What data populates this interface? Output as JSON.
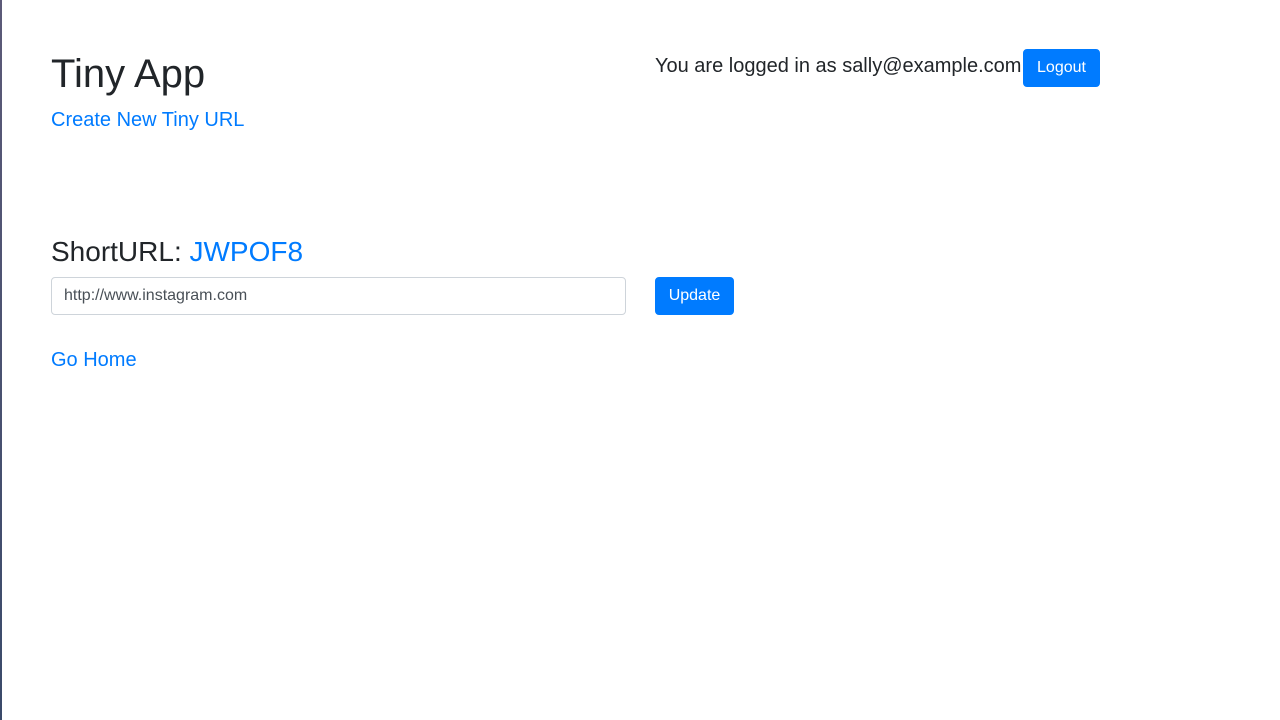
{
  "header": {
    "title": "Tiny App",
    "create_link": "Create New Tiny URL",
    "login_status": "You are logged in as sally@example.com",
    "logout_label": "Logout"
  },
  "main": {
    "short_url_label": "ShortURL:",
    "short_url_code": "JWPOF8",
    "long_url_value": "http://www.instagram.com",
    "update_label": "Update",
    "home_link": "Go Home"
  },
  "colors": {
    "accent": "#007bff",
    "text": "#212529",
    "input_border": "#ced4da"
  }
}
